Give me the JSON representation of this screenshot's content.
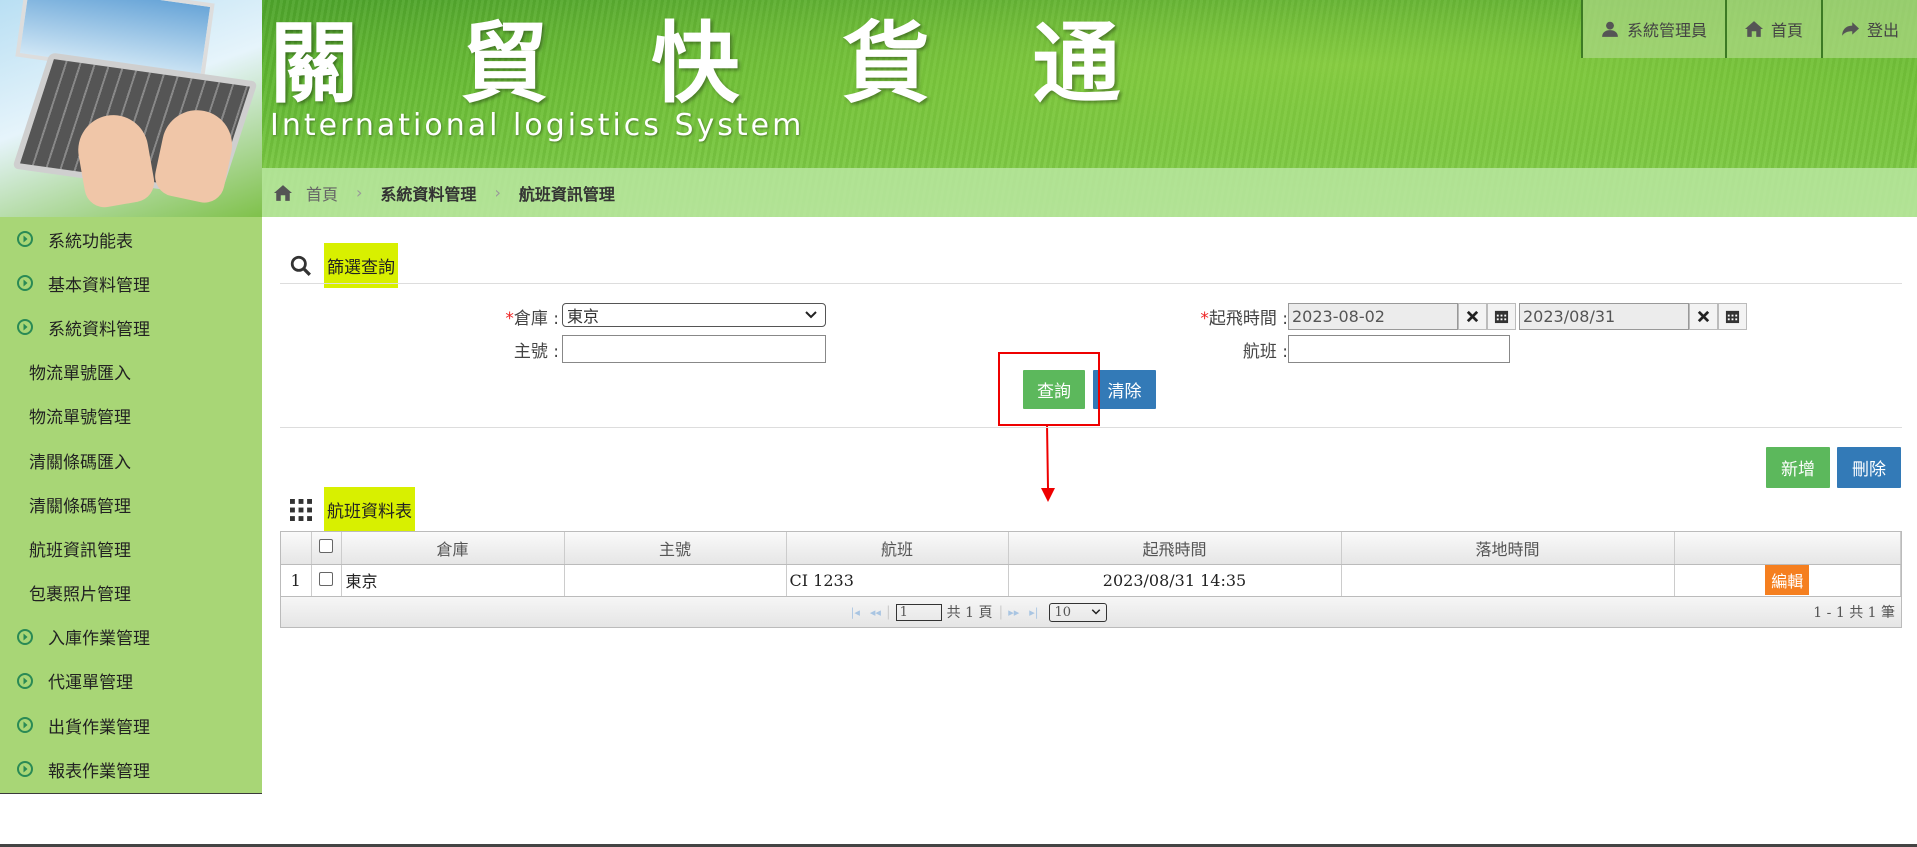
{
  "banner": {
    "title": "關 貿 快 貨 通",
    "subtitle": "International logistics System"
  },
  "top_nav": {
    "user_label": "系統管理員",
    "home_label": "首頁",
    "logout_label": "登出"
  },
  "breadcrumb": {
    "home": "首頁",
    "level1": "系統資料管理",
    "current": "航班資訊管理",
    "separator": "›"
  },
  "sidebar": {
    "items": [
      {
        "label": "系統功能表",
        "type": "main"
      },
      {
        "label": "基本資料管理",
        "type": "main"
      },
      {
        "label": "系統資料管理",
        "type": "main"
      },
      {
        "label": "物流單號匯入",
        "type": "sub"
      },
      {
        "label": "物流單號管理",
        "type": "sub"
      },
      {
        "label": "清關條碼匯入",
        "type": "sub"
      },
      {
        "label": "清關條碼管理",
        "type": "sub"
      },
      {
        "label": "航班資訊管理",
        "type": "sub"
      },
      {
        "label": "包裹照片管理",
        "type": "sub"
      },
      {
        "label": "入庫作業管理",
        "type": "main"
      },
      {
        "label": "代運單管理",
        "type": "main"
      },
      {
        "label": "出貨作業管理",
        "type": "main"
      },
      {
        "label": "報表作業管理",
        "type": "main"
      }
    ]
  },
  "filter": {
    "section_title": "篩選查詢",
    "required_mark": "*",
    "warehouse_label": "倉庫 :",
    "warehouse_value": "東京",
    "master_no_label": "主號 :",
    "master_no_value": "",
    "departure_label": "起飛時間 :",
    "departure_from": "2023-08-02",
    "departure_to": "2023/08/31",
    "flight_label": "航班 :",
    "flight_value": "",
    "query_label": "查詢",
    "clear_label": "清除"
  },
  "table_section": {
    "title": "航班資料表",
    "add_label": "新增",
    "delete_label": "刪除",
    "columns": [
      "倉庫",
      "主號",
      "航班",
      "起飛時間",
      "落地時間",
      ""
    ],
    "rows": [
      {
        "index": "1",
        "warehouse": "東京",
        "master_no": "",
        "flight": "CI 1233",
        "departure": "2023/08/31 14:35",
        "arrival": "",
        "edit_label": "編輯"
      }
    ],
    "pager": {
      "first_icon": "|◂",
      "prev_icon": "◂◂",
      "page_value": "1",
      "total_pages_text": "共 1 頁",
      "next_icon": "▸▸",
      "last_icon": "▸|",
      "page_size": "10",
      "summary": "1 - 1 共 1 筆"
    }
  },
  "colors": {
    "accent_green": "#5cb85c",
    "accent_blue": "#337ab7",
    "edit_orange": "#f57f1f",
    "section_highlight": "#d8f000",
    "sidebar_bg": "#a8d676",
    "annotation_red": "#e00000"
  }
}
